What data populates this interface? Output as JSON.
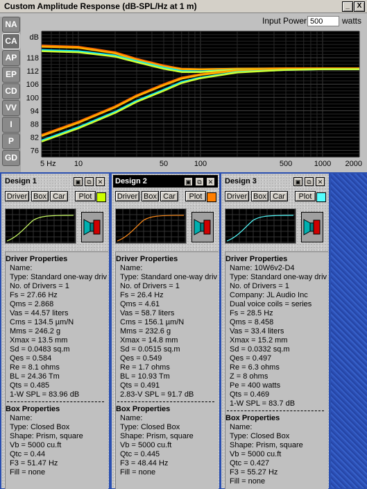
{
  "window": {
    "title": "Custom Amplitude Response (dB-SPL/Hz at 1 m)"
  },
  "window_buttons": {
    "minimize": "_",
    "close": "X"
  },
  "side_tabs": [
    "NA",
    "CA",
    "AP",
    "EP",
    "CD",
    "VV",
    "I",
    "P",
    "GD"
  ],
  "active_side_tab": "CA",
  "input_power": {
    "label": "Input Power:",
    "value": "500",
    "unit": "watts"
  },
  "chart_data": {
    "type": "line",
    "ylabel": "dB",
    "x_scale": "log",
    "xlim": [
      5,
      2000
    ],
    "ylim": [
      73,
      130
    ],
    "x_ticks": [
      5,
      10,
      50,
      100,
      500,
      1000,
      2000
    ],
    "x_tick_labels": [
      "5 Hz",
      "10",
      "50",
      "100",
      "500",
      "1000",
      "2000"
    ],
    "y_ticks": [
      76,
      82,
      88,
      94,
      100,
      106,
      112,
      118
    ],
    "y_tick_labels": [
      "76",
      "82",
      "88",
      "94",
      "100",
      "106",
      "112",
      "118"
    ],
    "grid": true,
    "background": "#000000",
    "series": [
      {
        "color": "#ff6a00",
        "x": [
          5,
          10,
          20,
          30,
          50,
          70,
          100,
          200,
          500,
          1000,
          2000
        ],
        "y": [
          123.5,
          123,
          120.5,
          117.5,
          114.5,
          113,
          112.8,
          113,
          113.2,
          113.2,
          113.2
        ]
      },
      {
        "color": "#ffb000",
        "x": [
          5,
          10,
          20,
          30,
          50,
          70,
          100,
          200,
          500,
          1000,
          2000
        ],
        "y": [
          123,
          122.5,
          120,
          117,
          114,
          112.8,
          112.7,
          113,
          113.1,
          113.1,
          113.1
        ]
      },
      {
        "color": "#00e8ff",
        "x": [
          5,
          10,
          20,
          30,
          50,
          70,
          100,
          200,
          500,
          1000,
          2000
        ],
        "y": [
          121.5,
          121,
          119,
          116.5,
          113.5,
          112,
          111.8,
          112.5,
          112.8,
          112.8,
          112.8
        ]
      },
      {
        "color": "#ccff33",
        "x": [
          5,
          10,
          20,
          30,
          50,
          70,
          100,
          200,
          500,
          1000,
          2000
        ],
        "y": [
          121,
          120.5,
          118.5,
          116,
          113,
          111.5,
          111.5,
          112.5,
          112.8,
          112.8,
          112.8
        ]
      },
      {
        "color": "#ff6a00",
        "x": [
          5,
          10,
          20,
          30,
          50,
          70,
          100,
          200,
          500,
          1000,
          2000
        ],
        "y": [
          83,
          89,
          96,
          101,
          106,
          109,
          110.5,
          112.3,
          113,
          113.2,
          113.2
        ]
      },
      {
        "color": "#ffb000",
        "x": [
          5,
          10,
          20,
          30,
          50,
          70,
          100,
          200,
          500,
          1000,
          2000
        ],
        "y": [
          82.5,
          88.5,
          95.5,
          100.5,
          105.5,
          108.5,
          110.2,
          112.2,
          113,
          113.1,
          113.1
        ]
      },
      {
        "color": "#00e8ff",
        "x": [
          5,
          10,
          20,
          30,
          50,
          70,
          100,
          200,
          500,
          1000,
          2000
        ],
        "y": [
          80.5,
          86.5,
          93.5,
          98.5,
          103.5,
          107,
          109,
          111.5,
          112.5,
          112.8,
          112.8
        ]
      },
      {
        "color": "#ccff33",
        "x": [
          5,
          10,
          20,
          30,
          50,
          70,
          100,
          200,
          500,
          1000,
          2000
        ],
        "y": [
          80,
          86,
          93,
          98,
          103,
          106.5,
          108.7,
          111.3,
          112.5,
          112.8,
          112.8
        ]
      }
    ]
  },
  "panel_buttons": {
    "driver": "Driver",
    "box": "Box",
    "car": "Car",
    "plot": "Plot"
  },
  "designs": [
    {
      "title": "Design 1",
      "color": "#ccff00",
      "curve_color": "#ccff66",
      "driver_header": "Driver Properties",
      "driver_lines": [
        "Name:",
        "Type: Standard one-way driv",
        "No. of Drivers = 1",
        "Fs = 27.66 Hz",
        "Qms = 2.868",
        "Vas = 44.57 liters",
        "Cms = 134.5 µm/N",
        "Mms = 246.2 g",
        "Xmax = 13.5 mm",
        "Sd = 0.0483 sq.m",
        "Qes = 0.584",
        "Re = 8.1 ohms",
        "BL = 24.36 Tm",
        "Qts = 0.485",
        "1-W SPL = 83.96 dB"
      ],
      "box_header": "Box Properties",
      "box_lines": [
        "Name:",
        "Type: Closed Box",
        "Shape: Prism, square",
        "Vb = 5000 cu.ft",
        "Qtc = 0.44",
        "F3 = 51.47 Hz",
        "Fill = none"
      ]
    },
    {
      "title": "Design 2",
      "color": "#ff7f00",
      "curve_color": "#ff8c1a",
      "driver_header": "Driver Properties",
      "driver_lines": [
        "Name:",
        "Type: Standard one-way driv",
        "No. of Drivers = 1",
        "Fs = 26.4 Hz",
        "Qms = 4.61",
        "Vas = 58.7 liters",
        "Cms = 156.1 µm/N",
        "Mms = 232.6 g",
        "Xmax = 14.8 mm",
        "Sd = 0.0515 sq.m",
        "Qes = 0.549",
        "Re = 1.7 ohms",
        "BL = 10.93 Tm",
        "Qts = 0.491",
        "2.83-V SPL = 91.7 dB"
      ],
      "box_header": "Box Properties",
      "box_lines": [
        "Name:",
        "Type: Closed Box",
        "Shape: Prism, square",
        "Vb = 5000 cu.ft",
        "Qtc = 0.445",
        "F3 = 48.44 Hz",
        "Fill = none"
      ]
    },
    {
      "title": "Design 3",
      "color": "#55ffff",
      "curve_color": "#55ffff",
      "driver_header": "Driver Properties",
      "driver_lines": [
        "Name: 10W6v2-D4",
        "Type: Standard one-way driv",
        "No. of Drivers = 1",
        "Company: JL Audio Inc",
        "Dual voice coils = series",
        "Fs = 28.5 Hz",
        "Qms = 8.458",
        "Vas = 33.4 liters",
        "Xmax = 15.2 mm",
        "Sd = 0.0332 sq.m",
        "Qes = 0.497",
        "Re = 6.3 ohms",
        "Z = 8 ohms",
        "Pe = 400 watts",
        "Qts = 0.469",
        "1-W SPL = 83.7 dB"
      ],
      "box_header": "Box Properties",
      "box_lines": [
        "Name:",
        "Type: Closed Box",
        "Shape: Prism, square",
        "Vb = 5000 cu.ft",
        "Qtc = 0.427",
        "F3 = 55.27 Hz",
        "Fill = none"
      ]
    }
  ]
}
